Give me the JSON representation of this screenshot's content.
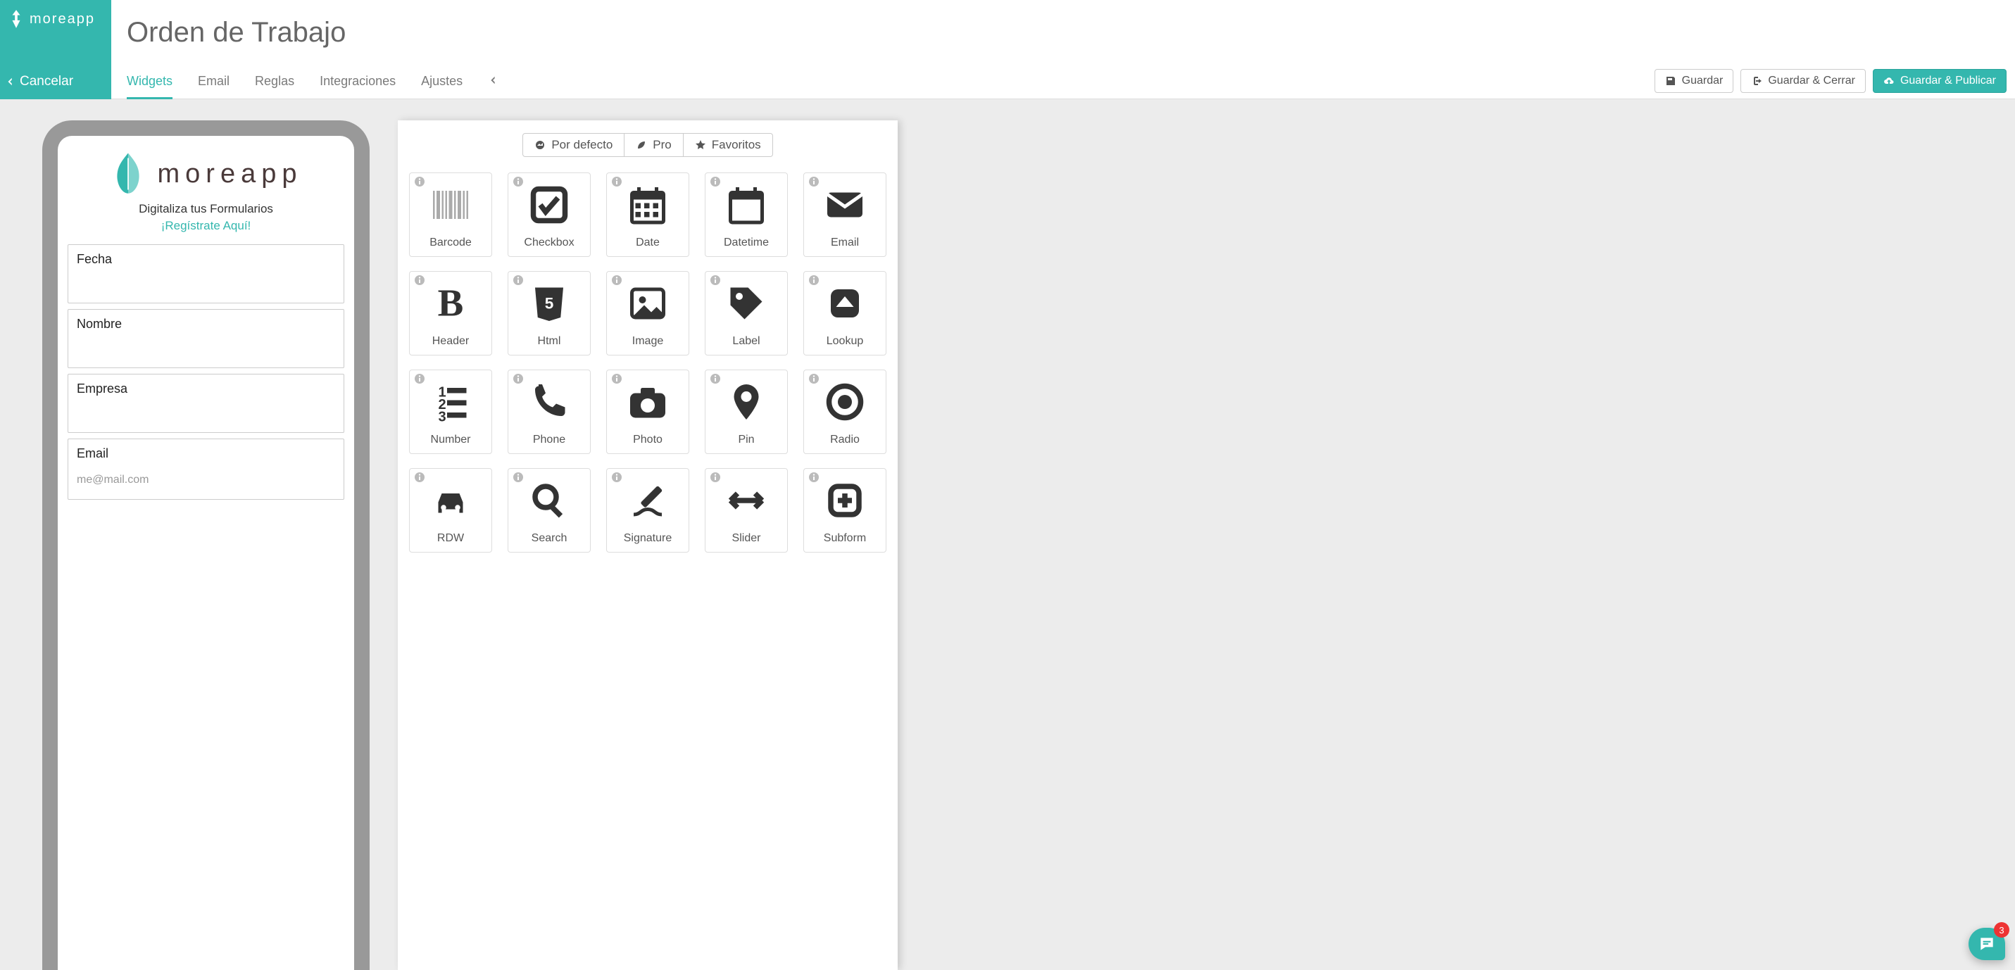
{
  "brand": {
    "name": "moreapp"
  },
  "header": {
    "cancel": "Cancelar",
    "title": "Orden de Trabajo"
  },
  "tabs": {
    "widgets": "Widgets",
    "email": "Email",
    "rules": "Reglas",
    "integrations": "Integraciones",
    "settings": "Ajustes"
  },
  "actions": {
    "save": "Guardar",
    "save_close": "Guardar & Cerrar",
    "save_publish": "Guardar & Publicar"
  },
  "preview": {
    "brand_text": "moreapp",
    "tagline": "Digitaliza tus Formularios",
    "cta": "¡Regístrate Aquí!",
    "fields": [
      {
        "label": "Fecha",
        "placeholder": ""
      },
      {
        "label": "Nombre",
        "placeholder": ""
      },
      {
        "label": "Empresa",
        "placeholder": ""
      },
      {
        "label": "Email",
        "placeholder": "me@mail.com"
      }
    ]
  },
  "palette_tabs": {
    "default": "Por defecto",
    "pro": "Pro",
    "favorites": "Favoritos"
  },
  "widgets": [
    {
      "icon": "barcode",
      "label": "Barcode"
    },
    {
      "icon": "checkbox",
      "label": "Checkbox"
    },
    {
      "icon": "date",
      "label": "Date"
    },
    {
      "icon": "datetime",
      "label": "Datetime"
    },
    {
      "icon": "email",
      "label": "Email"
    },
    {
      "icon": "header",
      "label": "Header"
    },
    {
      "icon": "html",
      "label": "Html"
    },
    {
      "icon": "image",
      "label": "Image"
    },
    {
      "icon": "label",
      "label": "Label"
    },
    {
      "icon": "lookup",
      "label": "Lookup"
    },
    {
      "icon": "number",
      "label": "Number"
    },
    {
      "icon": "phone",
      "label": "Phone"
    },
    {
      "icon": "photo",
      "label": "Photo"
    },
    {
      "icon": "pin",
      "label": "Pin"
    },
    {
      "icon": "radio",
      "label": "Radio"
    },
    {
      "icon": "rdw",
      "label": "RDW"
    },
    {
      "icon": "search",
      "label": "Search"
    },
    {
      "icon": "signature",
      "label": "Signature"
    },
    {
      "icon": "slider",
      "label": "Slider"
    },
    {
      "icon": "subform",
      "label": "Subform"
    }
  ],
  "chat": {
    "badge": "3"
  }
}
